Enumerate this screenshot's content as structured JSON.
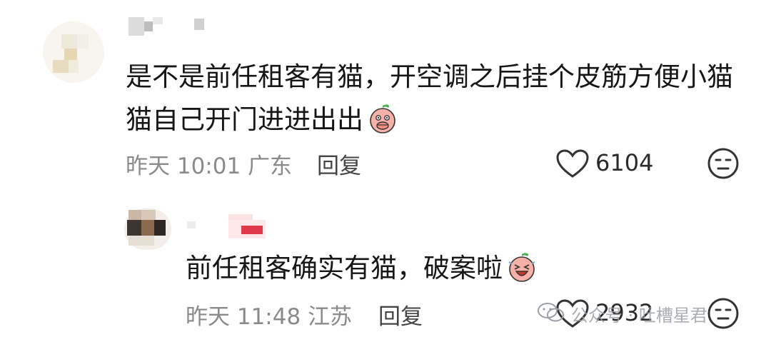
{
  "comments": [
    {
      "text_line1": "是不是前任租客有猫，开空调之后挂个皮筋方便小猫",
      "text_line2": "猫自己开门进进出出",
      "emoji_icon": "covering-mouth-peach-emoji",
      "time": "昨天 10:01",
      "location": "广东",
      "reply_label": "回复",
      "likes": "6104",
      "reaction_icon": "neutral-face-icon"
    },
    {
      "text": "前任租客确实有猫，破案啦",
      "emoji_icon": "laughing-peach-emoji",
      "time": "昨天 11:48",
      "location": "江苏",
      "reply_label": "回复",
      "likes": "2932",
      "reaction_icon": "neutral-face-icon"
    }
  ],
  "watermark": {
    "text": "公众号 · 吐槽星君",
    "icon": "wechat-icon"
  },
  "colors": {
    "text": "#161616",
    "meta": "#8a8a8a",
    "peach": "#f4a6a2",
    "leaf": "#4caf50"
  }
}
